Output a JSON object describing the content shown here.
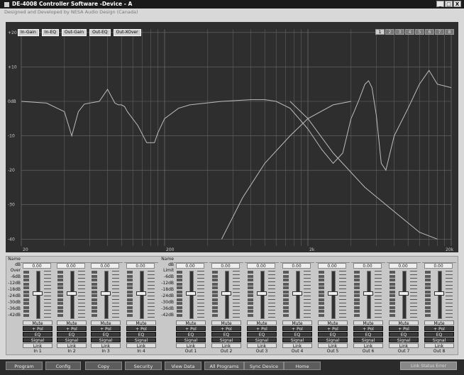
{
  "window": {
    "title": "DE-4008 Controller Software -Device - A",
    "subtitle": "Designed and Developed by NESA Audio Design (Canada)",
    "controls": [
      "_",
      "□",
      "X"
    ]
  },
  "graph": {
    "legend": [
      "In-Gain",
      "In-EQ",
      "Out-Gain",
      "Out-EQ",
      "Out-XOver"
    ],
    "banks": [
      "1",
      "2",
      "3",
      "4",
      "5",
      "6",
      "7",
      "8"
    ],
    "y_labels": [
      "+20",
      "+10",
      "0dB",
      "-10",
      "-20",
      "-30",
      "-40"
    ],
    "x_labels": [
      "20",
      "200",
      "2k",
      "20k"
    ],
    "colors": {
      "bg": "#2e2e2e",
      "grid": "#6a6a6a",
      "curve": "#bdbdbd"
    },
    "chart_data": {
      "type": "line",
      "xlabel": "",
      "ylabel": "",
      "xscale": "log",
      "xlim": [
        20,
        20000
      ],
      "ylim": [
        -42,
        21
      ],
      "series": [
        {
          "x": [
            20,
            30,
            40,
            45,
            50,
            55,
            60,
            70,
            80,
            90,
            95,
            100,
            105,
            110,
            130,
            150,
            170,
            180,
            200,
            250,
            300,
            500,
            800,
            1000,
            1200,
            1500,
            2000,
            2500,
            3000,
            3500,
            4000,
            4200,
            4500,
            5000,
            5300,
            5600,
            6000,
            6500,
            7000,
            8000,
            10000,
            12000,
            14000,
            16000,
            20000
          ],
          "y": [
            0,
            -0.5,
            -3,
            -10,
            -3,
            -0.8,
            -0.5,
            0,
            3.5,
            -0.5,
            -1,
            -1,
            -1.5,
            -3,
            -7,
            -12,
            -12,
            -9,
            -5,
            -2,
            -1,
            0,
            0.5,
            0.5,
            0,
            -2,
            -8,
            -14,
            -18,
            -15,
            -5,
            -3,
            0,
            5,
            6,
            4,
            -4,
            -18,
            -20,
            -10,
            -2,
            5,
            9,
            5,
            4
          ]
        },
        {
          "x": [
            500,
            700,
            1000,
            1500,
            2000,
            3000,
            4000
          ],
          "y": [
            -40,
            -28,
            -18,
            -10,
            -5,
            -1,
            0
          ]
        },
        {
          "x": [
            1500,
            2000,
            3000,
            5000,
            8000,
            12000,
            16000
          ],
          "y": [
            0,
            -5,
            -15,
            -25,
            -32,
            -38,
            -40
          ]
        }
      ]
    }
  },
  "mixer": {
    "scale_in": {
      "head": [
        "Name",
        "dB",
        "Over"
      ],
      "ticks": [
        "-6dB",
        "-12dB",
        "-18dB",
        "-24dB",
        "-30dB",
        "-36dB",
        "-42dB"
      ]
    },
    "scale_out": {
      "head": [
        "Name",
        "dB",
        "Limit"
      ],
      "ticks": [
        "-6dB",
        "-12dB",
        "-18dB",
        "-24dB",
        "-30dB",
        "-36dB",
        "-42dB"
      ]
    },
    "strips": [
      {
        "value": "0.00",
        "knob": 0.52,
        "buttons": [
          "Mute",
          "+ Pol",
          "EQ",
          "Signal",
          "Link"
        ],
        "label": "In 1"
      },
      {
        "value": "0.00",
        "knob": 0.52,
        "buttons": [
          "Mute",
          "+ Pol",
          "EQ",
          "Signal",
          "Link"
        ],
        "label": "In 2"
      },
      {
        "value": "0.00",
        "knob": 0.52,
        "buttons": [
          "Mute",
          "+ Pol",
          "EQ",
          "Signal",
          "Link"
        ],
        "label": "In 3"
      },
      {
        "value": "0.00",
        "knob": 0.52,
        "buttons": [
          "Mute",
          "+ Pol",
          "EQ",
          "Signal",
          "Link"
        ],
        "label": "In 4"
      },
      {
        "value": "0.00",
        "knob": 0.52,
        "buttons": [
          "Mute",
          "+ Pol",
          "EQ",
          "Signal",
          "Link"
        ],
        "label": "Out 1"
      },
      {
        "value": "0.00",
        "knob": 0.52,
        "buttons": [
          "Mute",
          "+ Pol",
          "EQ",
          "Signal",
          "Link"
        ],
        "label": "Out 2"
      },
      {
        "value": "0.00",
        "knob": 0.52,
        "buttons": [
          "Mute",
          "+ Pol",
          "EQ",
          "Signal",
          "Link"
        ],
        "label": "Out 3"
      },
      {
        "value": "0.00",
        "knob": 0.52,
        "buttons": [
          "Mute",
          "+ Pol",
          "EQ",
          "Signal",
          "Link"
        ],
        "label": "Out 4"
      },
      {
        "value": "0.00",
        "knob": 0.52,
        "buttons": [
          "Mute",
          "+ Pol",
          "EQ",
          "Signal",
          "Link"
        ],
        "label": "Out 5"
      },
      {
        "value": "0.00",
        "knob": 0.52,
        "buttons": [
          "Mute",
          "+ Pol",
          "EQ",
          "Signal",
          "Link"
        ],
        "label": "Out 6"
      },
      {
        "value": "0.00",
        "knob": 0.52,
        "buttons": [
          "Mute",
          "+ Pol",
          "EQ",
          "Signal",
          "Link"
        ],
        "label": "Out 7"
      },
      {
        "value": "0.00",
        "knob": 0.52,
        "buttons": [
          "Mute",
          "+ Pol",
          "EQ",
          "Signal",
          "Link"
        ],
        "label": "Out 8"
      }
    ]
  },
  "nav": {
    "buttons": [
      "Program",
      "Config",
      "Copy",
      "Security",
      "View Data",
      "All Programs",
      "Sync Device",
      "Home"
    ],
    "status": "Link Status Error"
  }
}
